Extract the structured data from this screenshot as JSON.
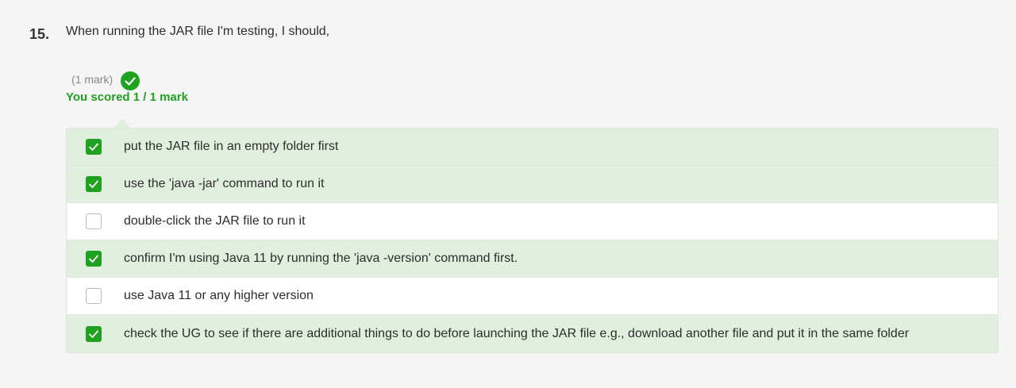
{
  "question": {
    "number": "15.",
    "text": "When running the JAR file I'm testing, I should,",
    "marks_label": "(1 mark)",
    "result_icon": "check-circle-icon",
    "score_text": "You scored 1 / 1 mark"
  },
  "colors": {
    "correct_green": "#22a122",
    "selected_bg": "#e1efde"
  },
  "options": [
    {
      "text": "put the JAR file in an empty folder first",
      "checked": true
    },
    {
      "text": "use the 'java -jar' command to run it",
      "checked": true
    },
    {
      "text": "double-click the JAR file to run it",
      "checked": false
    },
    {
      "text": "confirm I'm using Java 11 by running the 'java -version' command first.",
      "checked": true
    },
    {
      "text": "use Java 11 or any higher version",
      "checked": false
    },
    {
      "text": "check the UG to see if there are additional things to do before launching the JAR file e.g., download another file and put it in the same folder",
      "checked": true
    }
  ]
}
